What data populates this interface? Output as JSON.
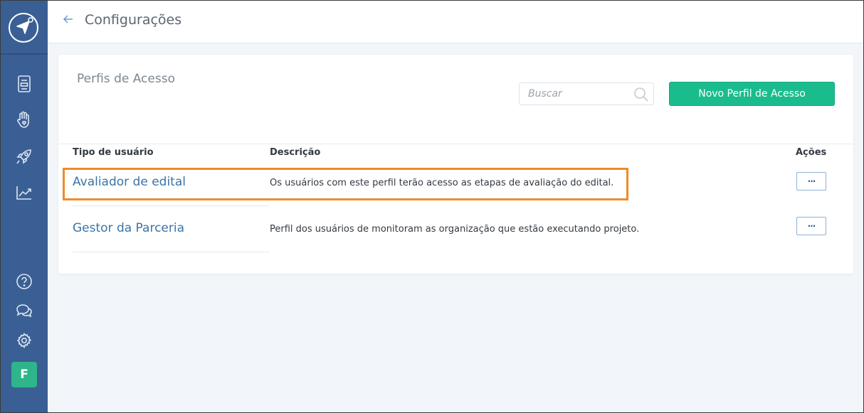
{
  "header": {
    "title": "Configurações"
  },
  "card": {
    "title": "Perfis de Acesso",
    "search_placeholder": "Buscar",
    "new_button": "Novo Perfil de Acesso"
  },
  "table": {
    "columns": [
      "Tipo de usuário",
      "Descrição",
      "Ações"
    ],
    "rows": [
      {
        "type": "Avaliador de edital",
        "description": "Os usuários com este perfil terão acesso as etapas de avaliação do edital.",
        "action": "···"
      },
      {
        "type": "Gestor da Parceria",
        "description": "Perfil dos usuários de monitoram as organização que estão executando projeto.",
        "action": "···"
      }
    ]
  },
  "sidebar": {
    "icons": [
      "logo-icon",
      "document-icon",
      "hand-heart-icon",
      "rocket-icon",
      "chart-icon",
      "help-icon",
      "chat-icon",
      "gear-icon"
    ],
    "avatar": "F"
  },
  "colors": {
    "sidebar": "#3a5f94",
    "accent_green": "#1abc8e",
    "link": "#3a74a8",
    "highlight": "#f08a2a"
  }
}
